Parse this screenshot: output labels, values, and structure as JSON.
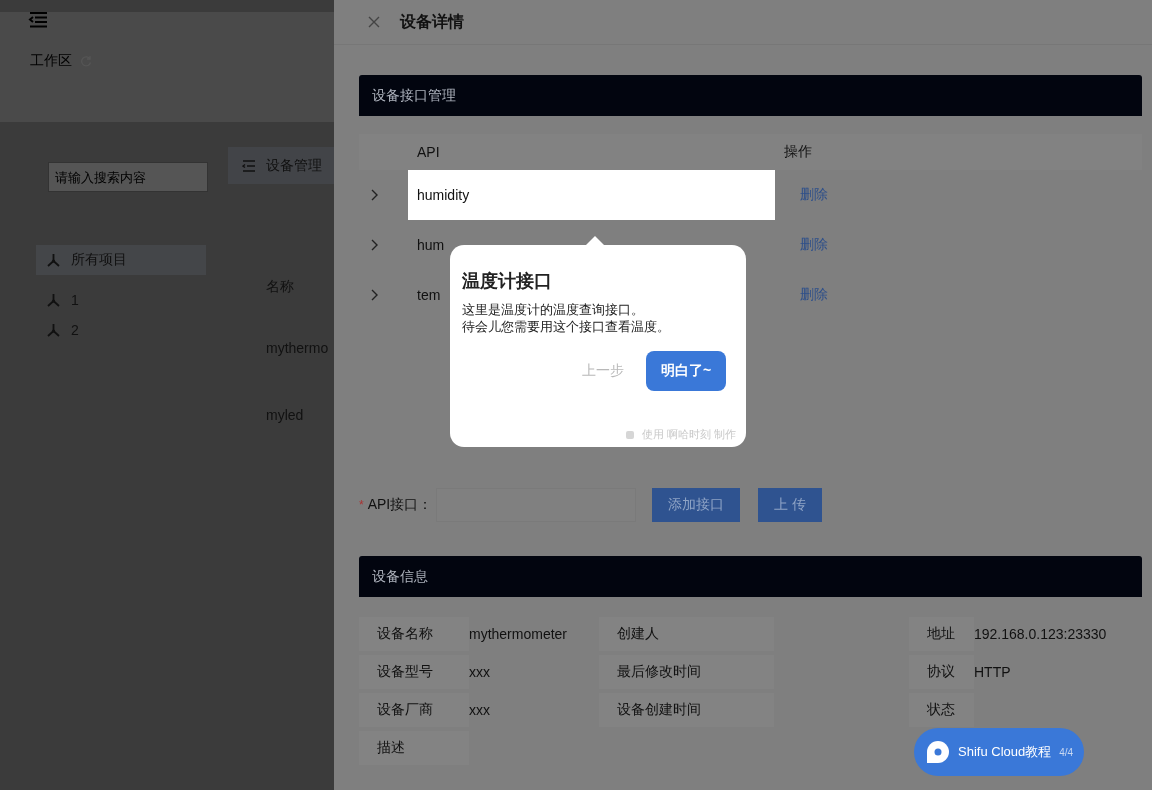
{
  "workspace": {
    "title": "工作区"
  },
  "search": {
    "placeholder": "请输入搜索内容"
  },
  "tab": {
    "label": "设备管理"
  },
  "projects": [
    {
      "label": "所有项目",
      "selected": true
    },
    {
      "label": "1",
      "selected": false
    },
    {
      "label": "2",
      "selected": false
    }
  ],
  "device_table": {
    "columns": [
      "名称"
    ],
    "rows": [
      "mythermo",
      "myled"
    ]
  },
  "drawer": {
    "title": "设备详情"
  },
  "api_section": {
    "title": "设备接口管理",
    "columns": [
      "API",
      "操作"
    ],
    "rows": [
      {
        "api": "humidity",
        "action": "删除",
        "highlighted": true
      },
      {
        "api": "hum",
        "action": "删除",
        "highlighted": false
      },
      {
        "api": "tem",
        "action": "删除",
        "highlighted": false
      }
    ]
  },
  "api_form": {
    "required_mark": "*",
    "label": "API接口：",
    "buttons": [
      "添加接口",
      "上 传"
    ]
  },
  "info_section": {
    "title": "设备信息",
    "fields": [
      {
        "label": "设备名称",
        "value": "mythermometer"
      },
      {
        "label": "创建人"
      },
      {
        "label": "地址",
        "value": "192.168.0.123:23330"
      },
      {
        "label": "设备型号",
        "value": "xxx"
      },
      {
        "label": "最后修改时间"
      },
      {
        "label": "协议",
        "value": "HTTP"
      },
      {
        "label": "设备厂商",
        "value": "xxx"
      },
      {
        "label": "设备创建时间"
      },
      {
        "label": "状态"
      },
      {
        "label": "描述"
      }
    ]
  },
  "tour": {
    "title": "温度计接口",
    "body": [
      "这里是温度计的温度查询接口。",
      "待会儿您需要用这个接口查看温度。"
    ],
    "prev": "上一步",
    "next": "明白了~",
    "footer": "使用 啊哈时刻 制作"
  },
  "tutorial_badge": {
    "label": "Shifu Cloud教程",
    "progress": "4/4"
  }
}
